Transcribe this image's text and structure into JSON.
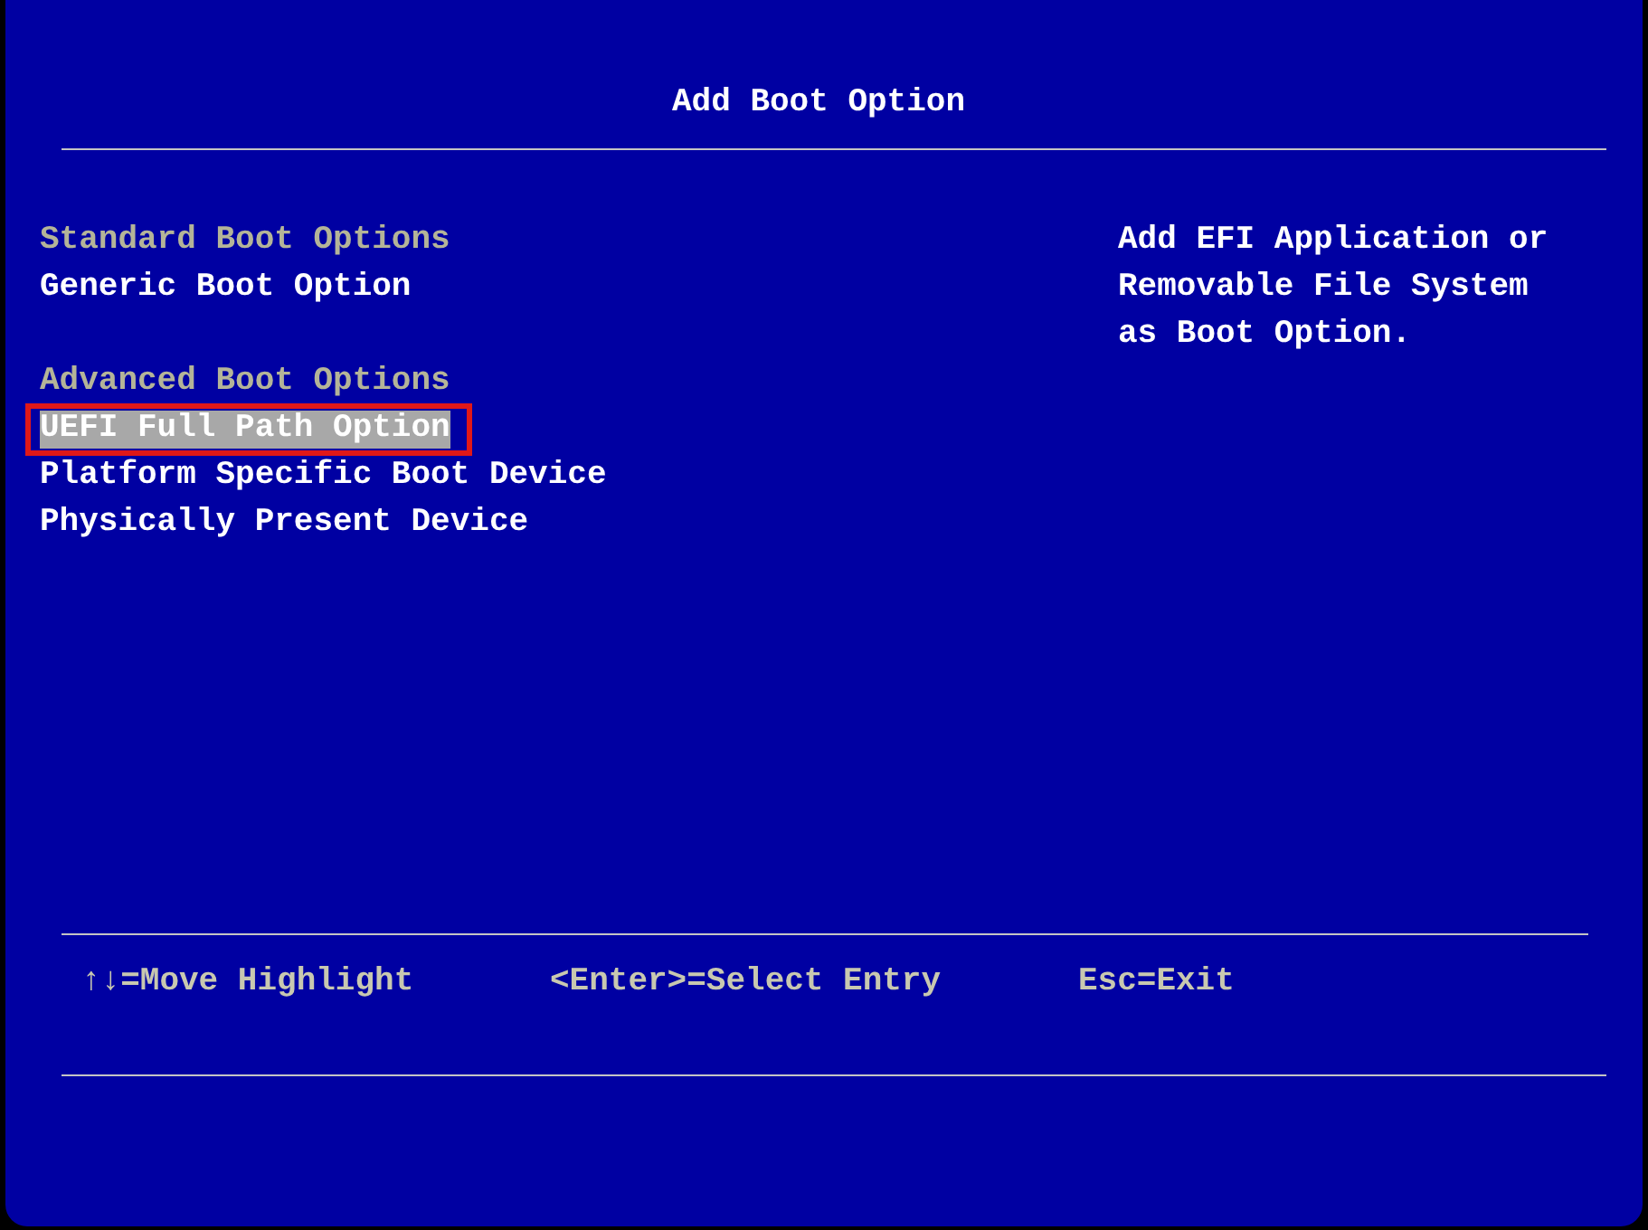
{
  "title": "Add Boot Option",
  "sections": [
    {
      "heading": "Standard Boot Options",
      "options": [
        {
          "label": "Generic Boot Option",
          "selected": false,
          "marked": false
        }
      ]
    },
    {
      "heading": "Advanced Boot Options",
      "options": [
        {
          "label": "UEFI Full Path Option",
          "selected": true,
          "marked": true
        },
        {
          "label": "Platform Specific Boot Device",
          "selected": false,
          "marked": false
        },
        {
          "label": "Physically Present Device",
          "selected": false,
          "marked": false
        }
      ]
    }
  ],
  "help_text": "Add EFI Application or Removable File System as Boot Option.",
  "key_hints": [
    "↑↓=Move Highlight",
    "<Enter>=Select Entry",
    "Esc=Exit"
  ]
}
